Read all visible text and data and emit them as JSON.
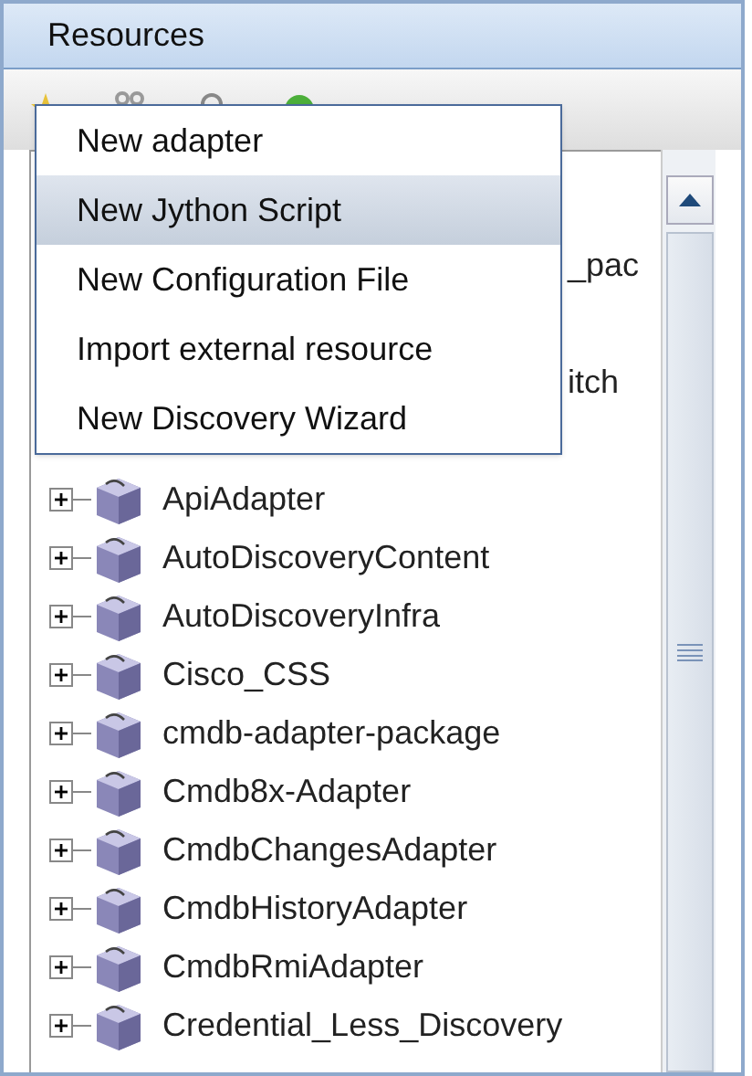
{
  "panel": {
    "title": "Resources"
  },
  "menu": {
    "items": [
      {
        "label": "New adapter",
        "selected": false
      },
      {
        "label": "New Jython Script",
        "selected": true
      },
      {
        "label": "New Configuration File",
        "selected": false
      },
      {
        "label": "Import external resource",
        "selected": false
      },
      {
        "label": "New Discovery Wizard",
        "selected": false
      }
    ]
  },
  "tree": {
    "items": [
      {
        "kind": "covered"
      },
      {
        "kind": "covered",
        "label": "_pac"
      },
      {
        "kind": "covered"
      },
      {
        "kind": "covered",
        "label": "itch"
      },
      {
        "kind": "covered"
      },
      {
        "kind": "node",
        "label": "ApiAdapter",
        "expanded": false
      },
      {
        "kind": "node",
        "label": "AutoDiscoveryContent",
        "expanded": false
      },
      {
        "kind": "node",
        "label": "AutoDiscoveryInfra",
        "expanded": false
      },
      {
        "kind": "node",
        "label": "Cisco_CSS",
        "expanded": false
      },
      {
        "kind": "node",
        "label": "cmdb-adapter-package",
        "expanded": false
      },
      {
        "kind": "node",
        "label": "Cmdb8x-Adapter",
        "expanded": false
      },
      {
        "kind": "node",
        "label": "CmdbChangesAdapter",
        "expanded": false
      },
      {
        "kind": "node",
        "label": "CmdbHistoryAdapter",
        "expanded": false
      },
      {
        "kind": "node",
        "label": "CmdbRmiAdapter",
        "expanded": false
      },
      {
        "kind": "node",
        "label": "Credential_Less_Discovery",
        "expanded": false
      }
    ]
  }
}
